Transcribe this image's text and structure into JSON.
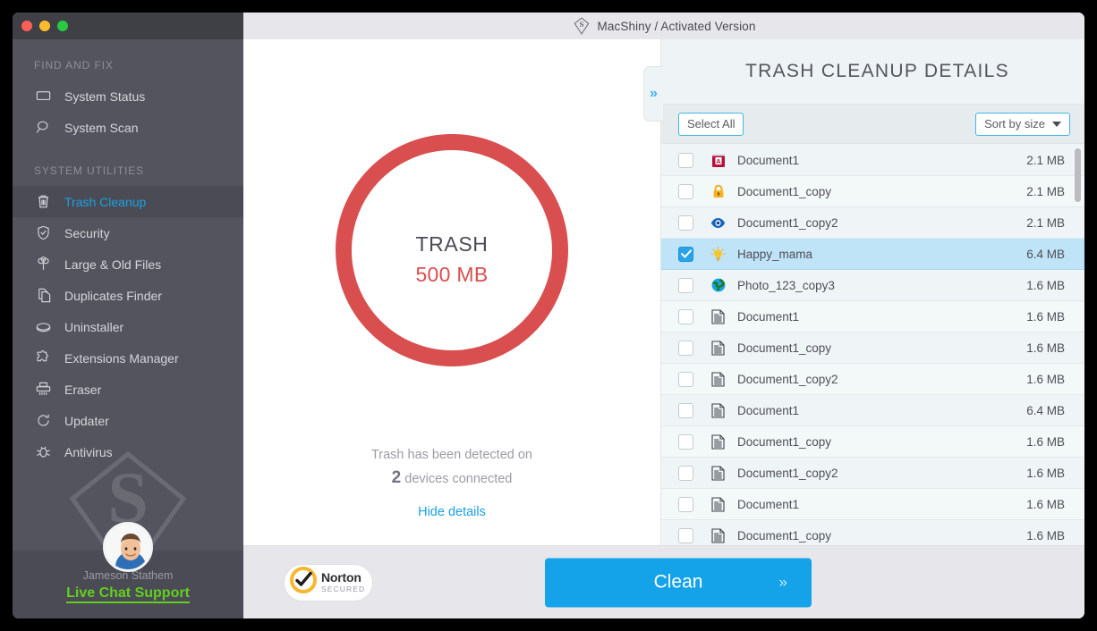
{
  "window": {
    "title": "MacShiny / Activated Version",
    "logo_icon": "shield-s-logo",
    "traffic_lights": [
      "close-button",
      "minimize-button",
      "zoom-button"
    ]
  },
  "sidebar": {
    "sections": [
      {
        "label": "FIND AND FIX"
      },
      {
        "label": "SYSTEM UTILITIES"
      }
    ],
    "find_and_fix": [
      {
        "label": "System Status",
        "icon": "monitor-icon",
        "active": false
      },
      {
        "label": "System Scan",
        "icon": "magnifier-icon",
        "active": false
      }
    ],
    "system_utilities": [
      {
        "label": "Trash Cleanup",
        "icon": "trash-icon",
        "active": true
      },
      {
        "label": "Security",
        "icon": "shield-check-icon",
        "active": false
      },
      {
        "label": "Large & Old Files",
        "icon": "tree-icon",
        "active": false
      },
      {
        "label": "Duplicates Finder",
        "icon": "copy-pages-icon",
        "active": false
      },
      {
        "label": "Uninstaller",
        "icon": "brush-icon",
        "active": false
      },
      {
        "label": "Extensions Manager",
        "icon": "puzzle-piece-icon",
        "active": false
      },
      {
        "label": "Eraser",
        "icon": "shredder-icon",
        "active": false
      },
      {
        "label": "Updater",
        "icon": "refresh-circle-icon",
        "active": false
      },
      {
        "label": "Antivirus",
        "icon": "bug-icon",
        "active": false
      }
    ],
    "support": {
      "agent_name": "Jameson Stathem",
      "chat_label": "Live Chat Support",
      "avatar_icon": "agent-avatar",
      "link_color": "#62cf1e"
    },
    "watermark_icon": "shield-s-watermark"
  },
  "center": {
    "donut": {
      "title": "TRASH",
      "size": "500 MB",
      "ring_color": "#d94f50"
    },
    "detected_prefix": "Trash has been detected on",
    "devices_count": "2",
    "devices_suffix": "devices connected",
    "hide_details_label": "Hide details",
    "link_color": "#18a0e8"
  },
  "details_panel": {
    "collapse_icon": "double-chevron-right-icon",
    "title": "TRASH CLEANUP DETAILS",
    "select_all_label": "Select All",
    "sort_label": "Sort by size",
    "sort_caret_icon": "caret-down-icon",
    "files": [
      {
        "name": "Document1",
        "size": "2.1 MB",
        "icon": "book-a-icon",
        "checked": false
      },
      {
        "name": "Document1_copy",
        "size": "2.1 MB",
        "icon": "lock-icon",
        "checked": false
      },
      {
        "name": "Document1_copy2",
        "size": "2.1 MB",
        "icon": "eye-icon",
        "checked": false
      },
      {
        "name": "Happy_mama",
        "size": "6.4 MB",
        "icon": "lightbulb-icon",
        "checked": true
      },
      {
        "name": "Photo_123_copy3",
        "size": "1.6 MB",
        "icon": "globe-icon",
        "checked": false
      },
      {
        "name": "Document1",
        "size": "1.6 MB",
        "icon": "document-icon",
        "checked": false
      },
      {
        "name": "Document1_copy",
        "size": "1.6 MB",
        "icon": "document-icon",
        "checked": false
      },
      {
        "name": "Document1_copy2",
        "size": "1.6 MB",
        "icon": "document-icon",
        "checked": false
      },
      {
        "name": "Document1",
        "size": "6.4 MB",
        "icon": "document-icon",
        "checked": false
      },
      {
        "name": "Document1_copy",
        "size": "1.6 MB",
        "icon": "document-icon",
        "checked": false
      },
      {
        "name": "Document1_copy2",
        "size": "1.6 MB",
        "icon": "document-icon",
        "checked": false
      },
      {
        "name": "Document1",
        "size": "1.6 MB",
        "icon": "document-icon",
        "checked": false
      },
      {
        "name": "Document1_copy",
        "size": "1.6 MB",
        "icon": "document-icon",
        "checked": false
      }
    ]
  },
  "bottom_bar": {
    "norton": {
      "line1": "Norton",
      "line2": "SECURED",
      "icon": "norton-check-icon"
    },
    "clean_label": "Clean",
    "clean_chevron": "double-chevron-right-icon",
    "clean_color": "#14a2e8"
  }
}
